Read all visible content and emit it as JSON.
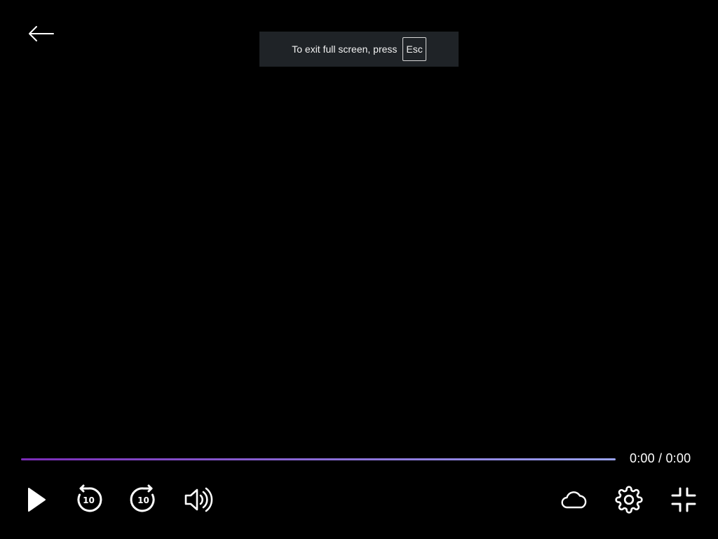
{
  "player": {
    "notice": {
      "text": "To exit full screen, press",
      "key": "Esc"
    },
    "time": {
      "current": "0:00",
      "separator": " / ",
      "duration": "0:00"
    },
    "progress": 0,
    "controls": {
      "rewind_seconds": "10",
      "forward_seconds": "10"
    },
    "colors": {
      "background": "#000000",
      "progress_start": "#7b2bb8",
      "progress_end": "#9aa3f0",
      "notice_bg": "#1f2327"
    },
    "icons": [
      "back-arrow-icon",
      "play-icon",
      "rewind-10-icon",
      "forward-10-icon",
      "volume-icon",
      "cloud-icon",
      "gear-icon",
      "exit-fullscreen-icon"
    ]
  }
}
